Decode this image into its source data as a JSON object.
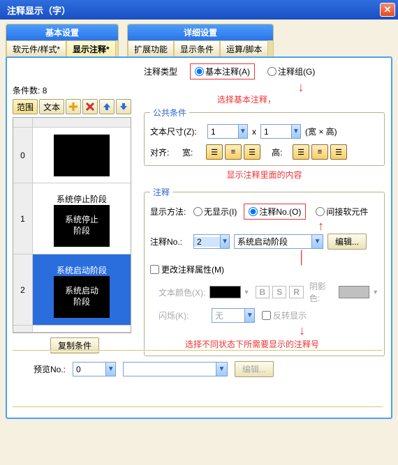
{
  "window": {
    "title": "注释显示（字）"
  },
  "tab_groups": {
    "basic": {
      "label": "基本设置",
      "tabs": [
        "软元件/样式*",
        "显示注释*"
      ],
      "active": 1
    },
    "detail": {
      "label": "详细设置",
      "tabs": [
        "扩展功能",
        "显示条件",
        "运算/脚本"
      ]
    }
  },
  "annotation_type": {
    "label": "注释类型",
    "opt_basic": "基本注释(A)",
    "opt_group": "注释组(G)",
    "hint": "选择基本注释，"
  },
  "conditions": {
    "label": "条件数:",
    "count": "8",
    "toolbar": {
      "range": "范围",
      "text": "文本",
      "add": "add-icon",
      "del": "del-icon",
      "up": "up-icon",
      "down": "down-icon"
    },
    "items": [
      {
        "idx": "0",
        "thumb": "",
        "caption": ""
      },
      {
        "idx": "1",
        "thumb": "系统停止\n阶段",
        "caption": "系统停止阶段"
      },
      {
        "idx": "2",
        "thumb": "系统启动\n阶段",
        "caption": "系统启动阶段",
        "selected": true
      }
    ],
    "copy_btn": "复制条件"
  },
  "common": {
    "legend": "公共条件",
    "text_size": "文本尺寸(Z):",
    "size_w": "1",
    "size_h": "1",
    "x": "x",
    "wh": "(宽 × 高)",
    "align": "对齐:",
    "width_lbl": "宽:",
    "height_lbl": "高:"
  },
  "comment_inside": "显示注释里面的内容",
  "comment": {
    "legend": "注释",
    "method": "显示方法:",
    "opt_none": "无显示(I)",
    "opt_no": "注释No.(O)",
    "opt_soft": "间接软元件",
    "no_label": "注释No.:",
    "no_value": "2",
    "no_name": "系统启动阶段",
    "edit": "编辑...",
    "change_attr": "更改注释属性(M)",
    "text_color": "文本颜色(X):",
    "bold": "B",
    "shadow": "S",
    "raised": "R",
    "shadow_color": "阴影色:",
    "blink": "闪烁(K):",
    "blink_val": "无",
    "reverse": "反转显示",
    "hint2": "选择不同状态下所需要显示的注释号"
  },
  "preview": {
    "label": "预览No.:",
    "value": "0",
    "text": "",
    "edit": "编辑..."
  },
  "colors": {
    "text_color": "#000000",
    "shadow_color": "#c0c0c0"
  }
}
